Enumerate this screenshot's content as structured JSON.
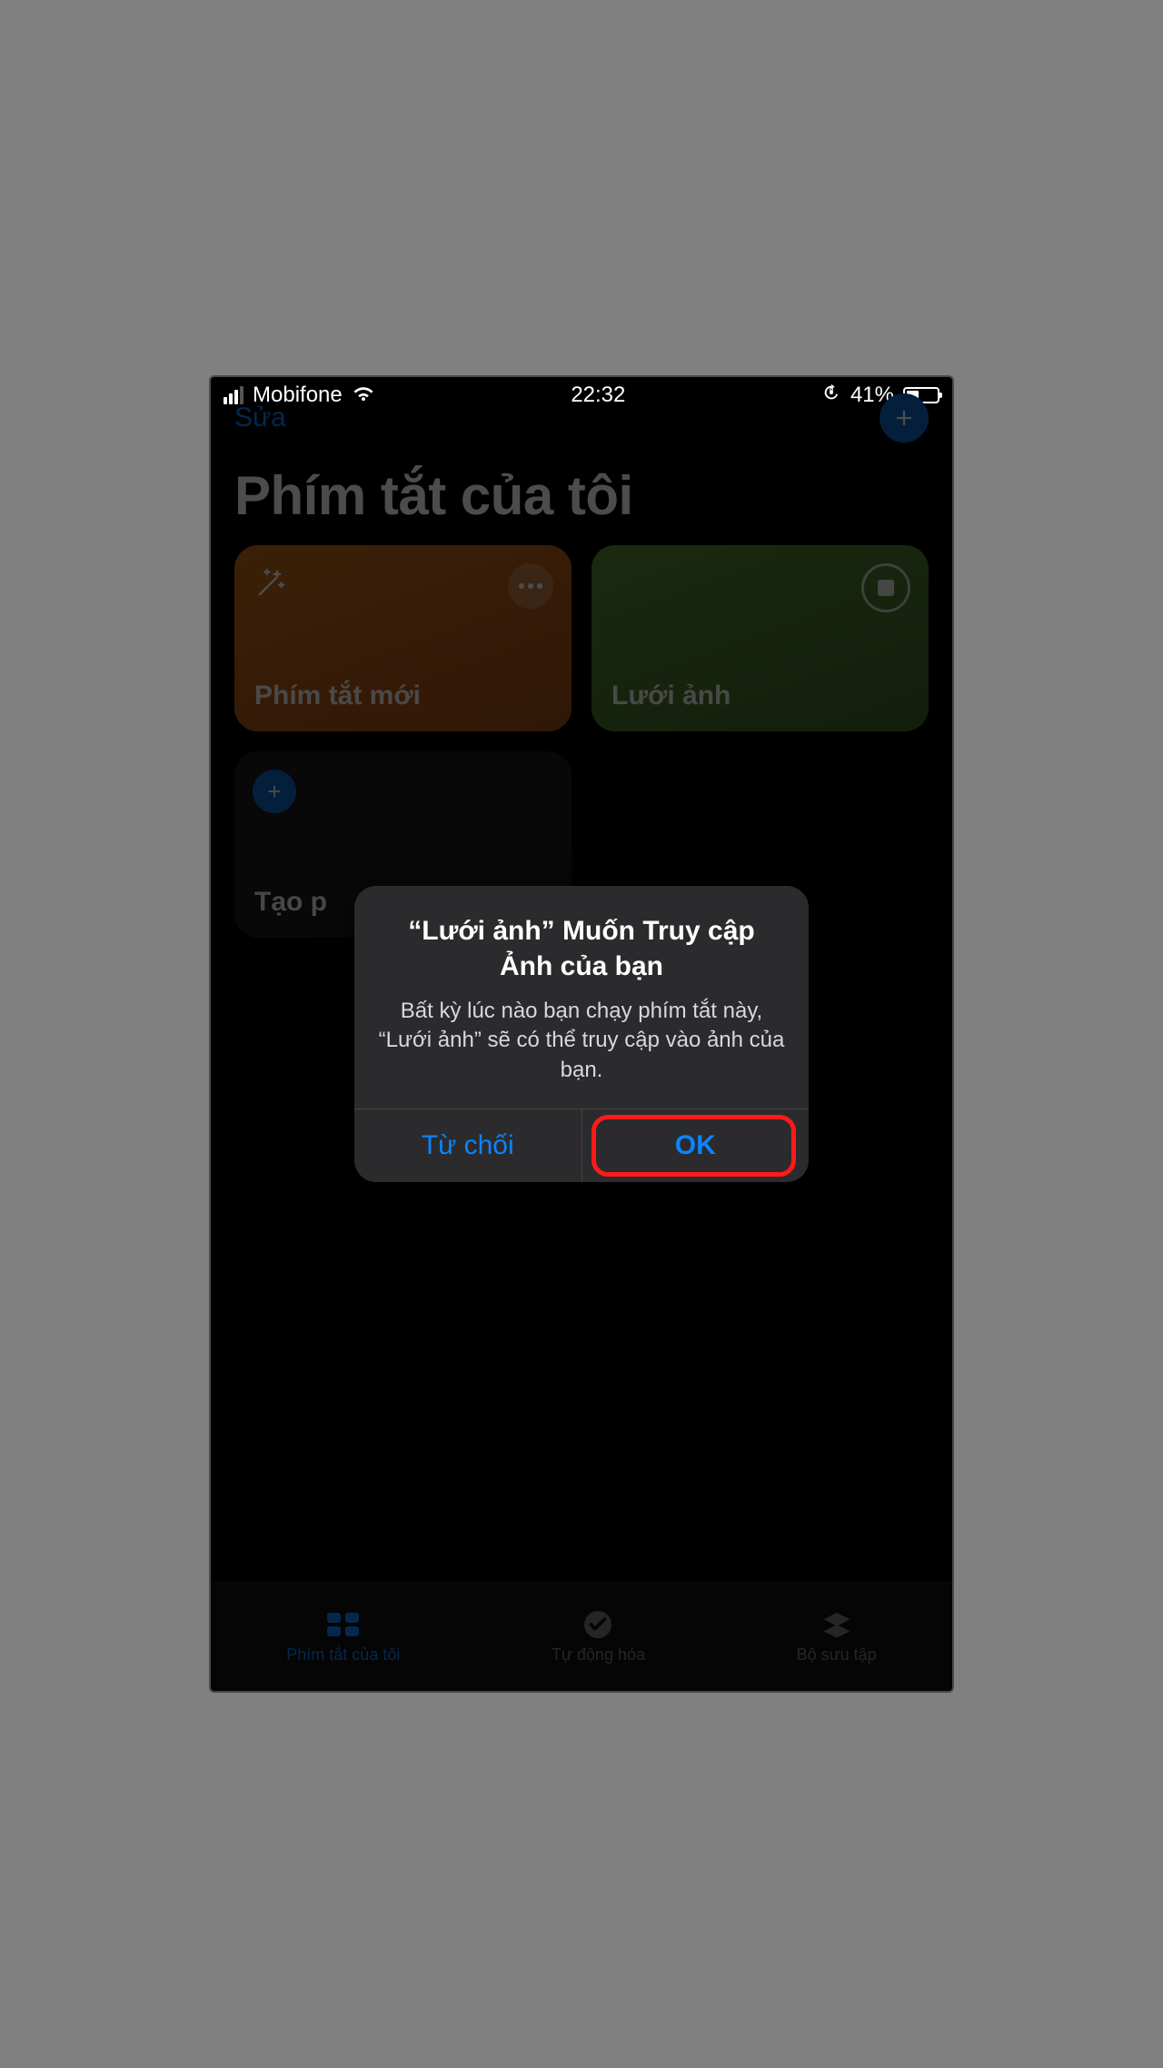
{
  "status": {
    "carrier": "Mobifone",
    "time": "22:32",
    "battery_text": "41%",
    "battery_fill_pct": 41
  },
  "header": {
    "edit_label": "Sửa"
  },
  "page": {
    "title": "Phím tắt của tôi"
  },
  "tiles": {
    "0": {
      "label": "Phím tắt mới"
    },
    "1": {
      "label": "Lưới ảnh"
    },
    "2": {
      "label": "Tạo p"
    }
  },
  "tabbar": {
    "shortcuts": "Phím tắt của tôi",
    "automation": "Tự động hóa",
    "gallery": "Bộ sưu tập"
  },
  "alert": {
    "title": "“Lưới ảnh” Muốn Truy cập Ảnh của bạn",
    "body": "Bất kỳ lúc nào bạn chạy phím tắt này, “Lưới ảnh” sẽ có thể truy cập vào ảnh của bạn.",
    "deny": "Từ chối",
    "ok": "OK"
  }
}
